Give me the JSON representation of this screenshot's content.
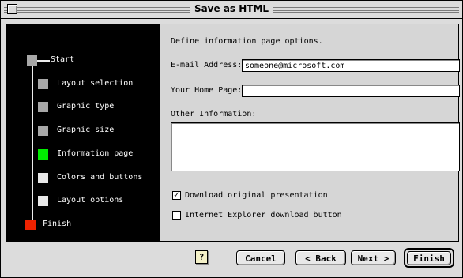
{
  "window": {
    "title": "Save as HTML"
  },
  "steps": [
    {
      "label": "Start",
      "color": "#a8a8a8"
    },
    {
      "label": "Layout selection",
      "color": "#a8a8a8"
    },
    {
      "label": "Graphic type",
      "color": "#a8a8a8"
    },
    {
      "label": "Graphic size",
      "color": "#a8a8a8"
    },
    {
      "label": "Information page",
      "color": "#00ee00"
    },
    {
      "label": "Colors and buttons",
      "color": "#e8e8e8"
    },
    {
      "label": "Layout options",
      "color": "#e8e8e8"
    },
    {
      "label": "Finish",
      "color": "#ee2200"
    }
  ],
  "form": {
    "heading": "Define information page options.",
    "email_label": "E-mail Address:",
    "email_value": "someone@microsoft.com",
    "home_label": "Your Home Page:",
    "home_value": "",
    "other_label": "Other Information:",
    "other_value": "",
    "download_label": "Download original presentation",
    "download_checked": true,
    "ie_label": "Internet Explorer download button",
    "ie_checked": false
  },
  "buttons": {
    "help": "?",
    "cancel": "Cancel",
    "back": "< Back",
    "next": "Next >",
    "finish": "Finish"
  }
}
